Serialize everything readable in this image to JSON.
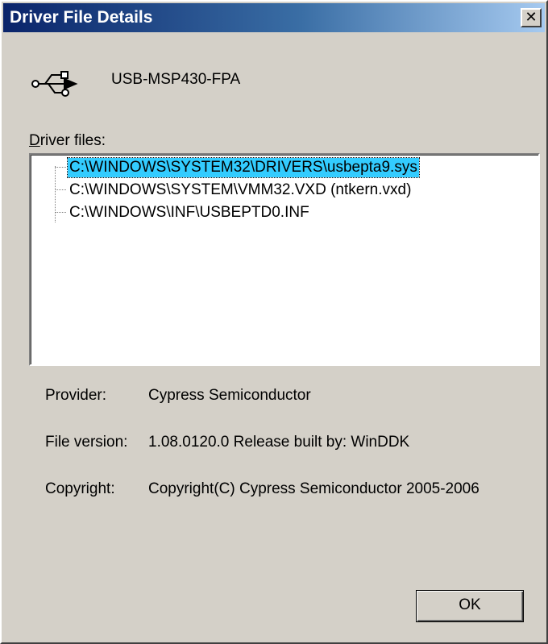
{
  "window": {
    "title": "Driver File Details",
    "close_glyph": "✕"
  },
  "device": {
    "icon": "usb-icon",
    "name": "USB-MSP430-FPA"
  },
  "files": {
    "label_accel": "D",
    "label_rest": "river files:",
    "items": [
      {
        "path": "C:\\WINDOWS\\SYSTEM32\\DRIVERS\\usbepta9.sys",
        "selected": true
      },
      {
        "path": "C:\\WINDOWS\\SYSTEM\\VMM32.VXD (ntkern.vxd)",
        "selected": false
      },
      {
        "path": "C:\\WINDOWS\\INF\\USBEPTD0.INF",
        "selected": false
      }
    ]
  },
  "info": {
    "provider_label": "Provider:",
    "provider_value": "Cypress Semiconductor",
    "version_label": "File version:",
    "version_value": "1.08.0120.0 Release built by: WinDDK",
    "copyright_label": "Copyright:",
    "copyright_value": "Copyright(C) Cypress Semiconductor 2005-2006"
  },
  "buttons": {
    "ok_label": "OK"
  },
  "colors": {
    "titlebar_start": "#0a246a",
    "titlebar_end": "#a6caf0",
    "dialog_bg": "#d4d0c8",
    "selection": "#33ccff"
  }
}
